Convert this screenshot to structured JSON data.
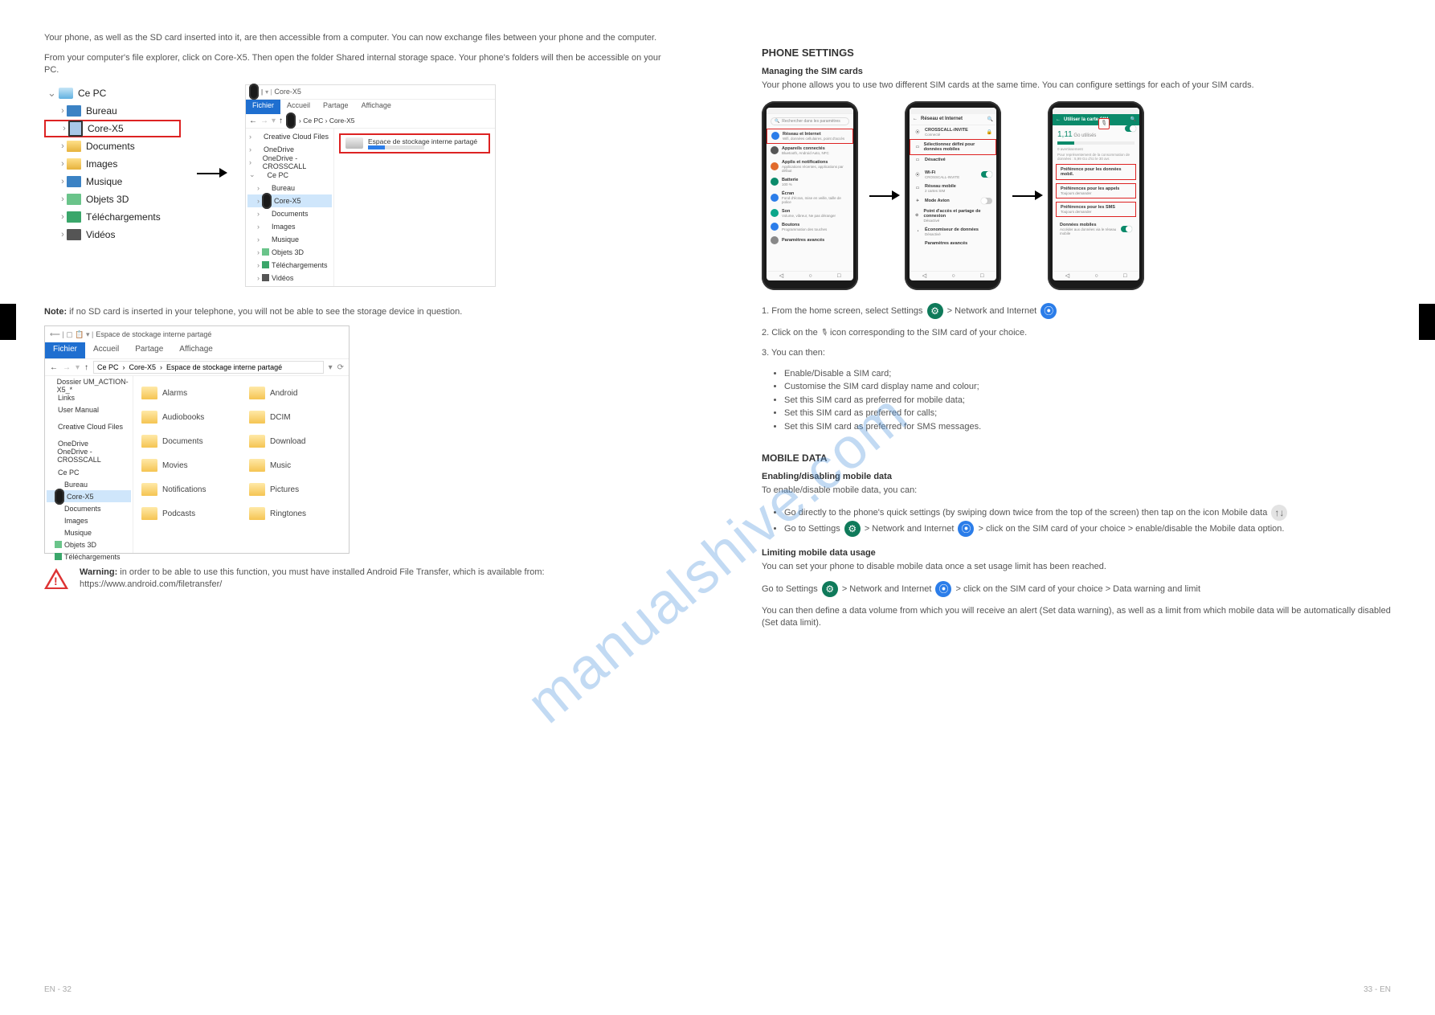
{
  "watermark": "manualshive.com",
  "leftPage": {
    "intro1": "Your phone, as well as the SD card inserted into it, are then accessible from a computer. You can now exchange files between your phone and the computer.",
    "intro2": "From your computer's file explorer, click on Core-X5. Then open the folder Shared internal storage space. Your phone's folders will then be accessible on your PC.",
    "tree_root": "Ce PC",
    "tree_items": [
      "Bureau",
      "Core-X5",
      "Documents",
      "Images",
      "Musique",
      "Objets 3D",
      "Téléchargements",
      "Vidéos"
    ],
    "smallExplorer": {
      "title": "Core-X5",
      "tabs": [
        "Fichier",
        "Accueil",
        "Partage",
        "Affichage"
      ],
      "path": [
        "Ce PC",
        "Core-X5"
      ],
      "side": [
        "Creative Cloud Files",
        "OneDrive",
        "OneDrive - CROSSCALL",
        "Ce PC",
        "Bureau",
        "Core-X5",
        "Documents",
        "Images",
        "Musique",
        "Objets 3D",
        "Téléchargements",
        "Vidéos"
      ],
      "drive_label": "Espace de stockage interne partagé"
    },
    "bigExplorer": {
      "title": "Espace de stockage interne partagé",
      "tabs": [
        "Fichier",
        "Accueil",
        "Partage",
        "Affichage"
      ],
      "path": "Ce PC  ›  Core-X5  ›  Espace de stockage interne partagé",
      "side_top": [
        "Dossier UM_ACTION-X5_*",
        "Links",
        "User Manual"
      ],
      "side_mid": [
        "Creative Cloud Files",
        "OneDrive",
        "OneDrive - CROSSCALL"
      ],
      "side_pc": [
        "Ce PC",
        "Bureau",
        "Core-X5",
        "Documents",
        "Images",
        "Musique",
        "Objets 3D",
        "Téléchargements"
      ],
      "folders": [
        "Alarms",
        "Android",
        "Audiobooks",
        "DCIM",
        "Documents",
        "Download",
        "Movies",
        "Music",
        "Notifications",
        "Pictures",
        "Podcasts",
        "Ringtones"
      ]
    },
    "note_bold": "Note:",
    "note_text": " if no SD card is inserted in your telephone, you will not be able to see the storage device in question.",
    "warn_bold": "Warning:",
    "warn_text": " in order to be able to use this function, you must have installed Android File Transfer, which is available from: https://www.android.com/filetransfer/",
    "footer": "EN - 32"
  },
  "rightPage": {
    "h1": "PHONE SETTINGS",
    "h2": "Managing the SIM cards",
    "p1": "Your phone allows you to use two different SIM cards at the same time. You can configure settings for each of your SIM cards.",
    "steps_title": "",
    "step1": "1. From the home screen, select Settings ",
    "step1b": " > Network and Internet ",
    "step2": "2. Click on the ",
    "step2b": " icon corresponding to the SIM card of your choice.",
    "step3": "3. You can then:",
    "bullets": [
      "Enable/Disable a SIM card;",
      "Customise the SIM card display name and colour;",
      "Set this SIM card as preferred for mobile data;",
      "Set this SIM card as preferred for calls;",
      "Set this SIM card as preferred for SMS messages."
    ],
    "sec2": "Mobile data",
    "sub1": "Enabling/disabling mobile data",
    "sub1t1": "To enable/disable mobile data, you can:",
    "sub1b": [
      "Go directly to the phone's quick settings (by swiping down twice from the top of the screen) then tap on the icon Mobile data ",
      "Go to Settings  > Network and Internet > click on the SIM card of your choice > enable/disable the Mobile data option."
    ],
    "sub2": "Limiting mobile data usage",
    "sub2p1": "You can set your phone to disable mobile data once a set usage limit has been reached.",
    "sub2p2a": "Go to Settings ",
    "sub2p2b": " > Network and Internet ",
    "sub2p2c": " > click on the SIM card of your choice > Data warning and limit",
    "sub2p3": "You can then define a data volume from which you will receive an alert (Set data warning), as well as a limit from which mobile data will be automatically disabled (Set data limit).",
    "footer": "33 - EN",
    "phone_common": {
      "back": "←",
      "tri": "◁",
      "circ": "○",
      "sq": "□",
      "search": "🔍",
      "gear": "⚙",
      "wifi": "⦿",
      "lock": "🔒",
      "pencil": "✎"
    },
    "phone1": {
      "search_placeholder": "Rechercher dans les paramètres",
      "items": [
        {
          "c": "#2b7de9",
          "t1": "Réseau et Internet",
          "t2": "Wifi, données cellulaires, point d'accès"
        },
        {
          "c": "#444",
          "t1": "Appareils connectés",
          "t2": "Bluetooth, Android Auto, NFC"
        },
        {
          "c": "#e06a2b",
          "t1": "Applis et notifications",
          "t2": "Applications récentes, applications par défaut"
        },
        {
          "c": "#0a8a6a",
          "t1": "Batterie",
          "t2": "100 %"
        },
        {
          "c": "#2b7de9",
          "t1": "Écran",
          "t2": "Fond d'écran, mise en veille, taille de police"
        },
        {
          "c": "#0aa68a",
          "t1": "Son",
          "t2": "Volume, vibreur, Ne pas déranger"
        },
        {
          "c": "#2b7de9",
          "t1": "Boutons",
          "t2": "Programmation des touches"
        },
        {
          "c": "#6a2be0",
          "t1": "Paramètres avancés",
          "t2": ""
        }
      ]
    },
    "phone2": {
      "title": "Réseau et Internet",
      "items": [
        {
          "t1": "CROSSCALL-INVITE",
          "t2": "Connecté",
          "icon": "wifi",
          "lock": true
        },
        {
          "t1": "Sélectionnez défini pour données mobiles",
          "t2": "",
          "icon": "sim",
          "red": true
        },
        {
          "t1": "Désactivé",
          "t2": "",
          "icon": "sim"
        },
        {
          "t1": "Wi-Fi",
          "t2": "CROSSCALL-INVITE",
          "icon": "wifi",
          "toggle": true
        },
        {
          "t1": "Réseau mobile",
          "t2": "2 cartes SIM",
          "icon": "sim"
        },
        {
          "t1": "Mode Avion",
          "t2": "",
          "icon": "plane",
          "toggle": false
        },
        {
          "t1": "Point d'accès et partage de connexion",
          "t2": "Désactivé",
          "icon": "hotspot"
        },
        {
          "t1": "Économiseur de données",
          "t2": "Désactivé",
          "icon": "data"
        },
        {
          "t1": "Paramètres avancés",
          "t2": ""
        }
      ]
    },
    "phone3": {
      "title": "Utiliser la carte SIM",
      "usage_val": "1,11",
      "usage_unit": " Go utilisés",
      "usage_sub1": "0 avertissement",
      "usage_sub2": "Pour représentement de la consommation de données : 5,99 Go d'ici le 30 avr.",
      "rows": [
        {
          "t": "Préférence pour les données mobil.",
          "red": true,
          "sub": ""
        },
        {
          "t": "Préférences pour les appels",
          "red": true,
          "sub": "Toujours demander"
        },
        {
          "t": "Préférences pour les SMS",
          "red": true,
          "sub": "Toujours demander"
        },
        {
          "t": "Données mobiles",
          "red": false,
          "sub": "Accéder aux données via le réseau mobile",
          "toggle": true
        }
      ]
    }
  }
}
